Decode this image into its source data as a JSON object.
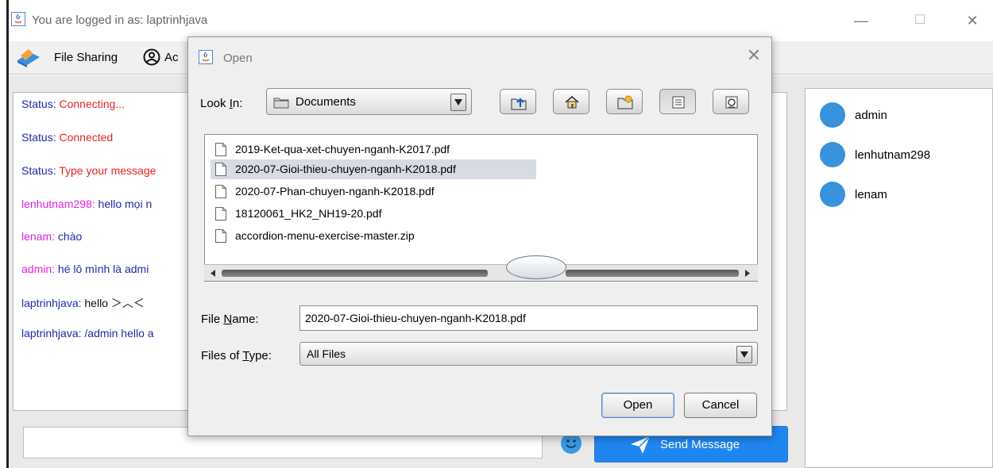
{
  "main_window": {
    "title": "You are logged in as: laptrinhjava",
    "minimize_glyph": "—",
    "maximize_glyph": "☐",
    "close_glyph": "✕"
  },
  "menu": {
    "file_sharing_label": "File Sharing",
    "account_label": "Ac"
  },
  "chat": {
    "messages": [
      {
        "name": "Status: ",
        "text": "Connecting...",
        "kind": "status"
      },
      {
        "name": "Status: ",
        "text": "Connected",
        "kind": "status"
      },
      {
        "name": "Status: ",
        "text": "Type your message",
        "kind": "status"
      },
      {
        "name": "lenhutnam298: ",
        "text": "hello mọi n",
        "kind": "user"
      },
      {
        "name": "lenam: ",
        "text": "chào",
        "kind": "user"
      },
      {
        "name": "admin: ",
        "text": "hé lô mình là admi",
        "kind": "user"
      },
      {
        "name": "laptrinhjava: ",
        "text": "hello ＞︿＜",
        "kind": "self"
      },
      {
        "name": "laptrinhjava: ",
        "text": "/admin hello a",
        "kind": "self"
      }
    ],
    "input_value": "",
    "send_label": "Send Message"
  },
  "users": [
    "admin",
    "lenhutnam298",
    "lenam"
  ],
  "dialog": {
    "title": "Open",
    "close_glyph": "✕",
    "look_in_label_pre": "Look ",
    "look_in_label_mnemonic": "I",
    "look_in_label_post": "n:",
    "look_in_value": "Documents",
    "files": [
      "2019-Ket-qua-xet-chuyen-nganh-K2017.pdf",
      "2020-07-Gioi-thieu-chuyen-nganh-K2018.pdf",
      "2020-07-Phan-chuyen-nganh-K2018.pdf",
      "18120061_HK2_NH19-20.pdf",
      "accordion-menu-exercise-master.zip"
    ],
    "selected_index": 1,
    "file_name_label_pre": "File ",
    "file_name_label_mnemonic": "N",
    "file_name_label_post": "ame:",
    "file_name_value": "2020-07-Gioi-thieu-chuyen-nganh-K2018.pdf",
    "file_type_label_pre": "Files of ",
    "file_type_label_mnemonic": "T",
    "file_type_label_post": "ype:",
    "file_type_value": "All Files",
    "open_label": "Open",
    "cancel_label": "Cancel"
  },
  "colors": {
    "status_key": "#1f2aa8",
    "status_value": "#e42222",
    "other_user": "#e020e0",
    "self_user": "#1f2aa8",
    "send_button": "#1f86f0",
    "avatar": "#3892dc",
    "selection": "#d6dbe4"
  }
}
